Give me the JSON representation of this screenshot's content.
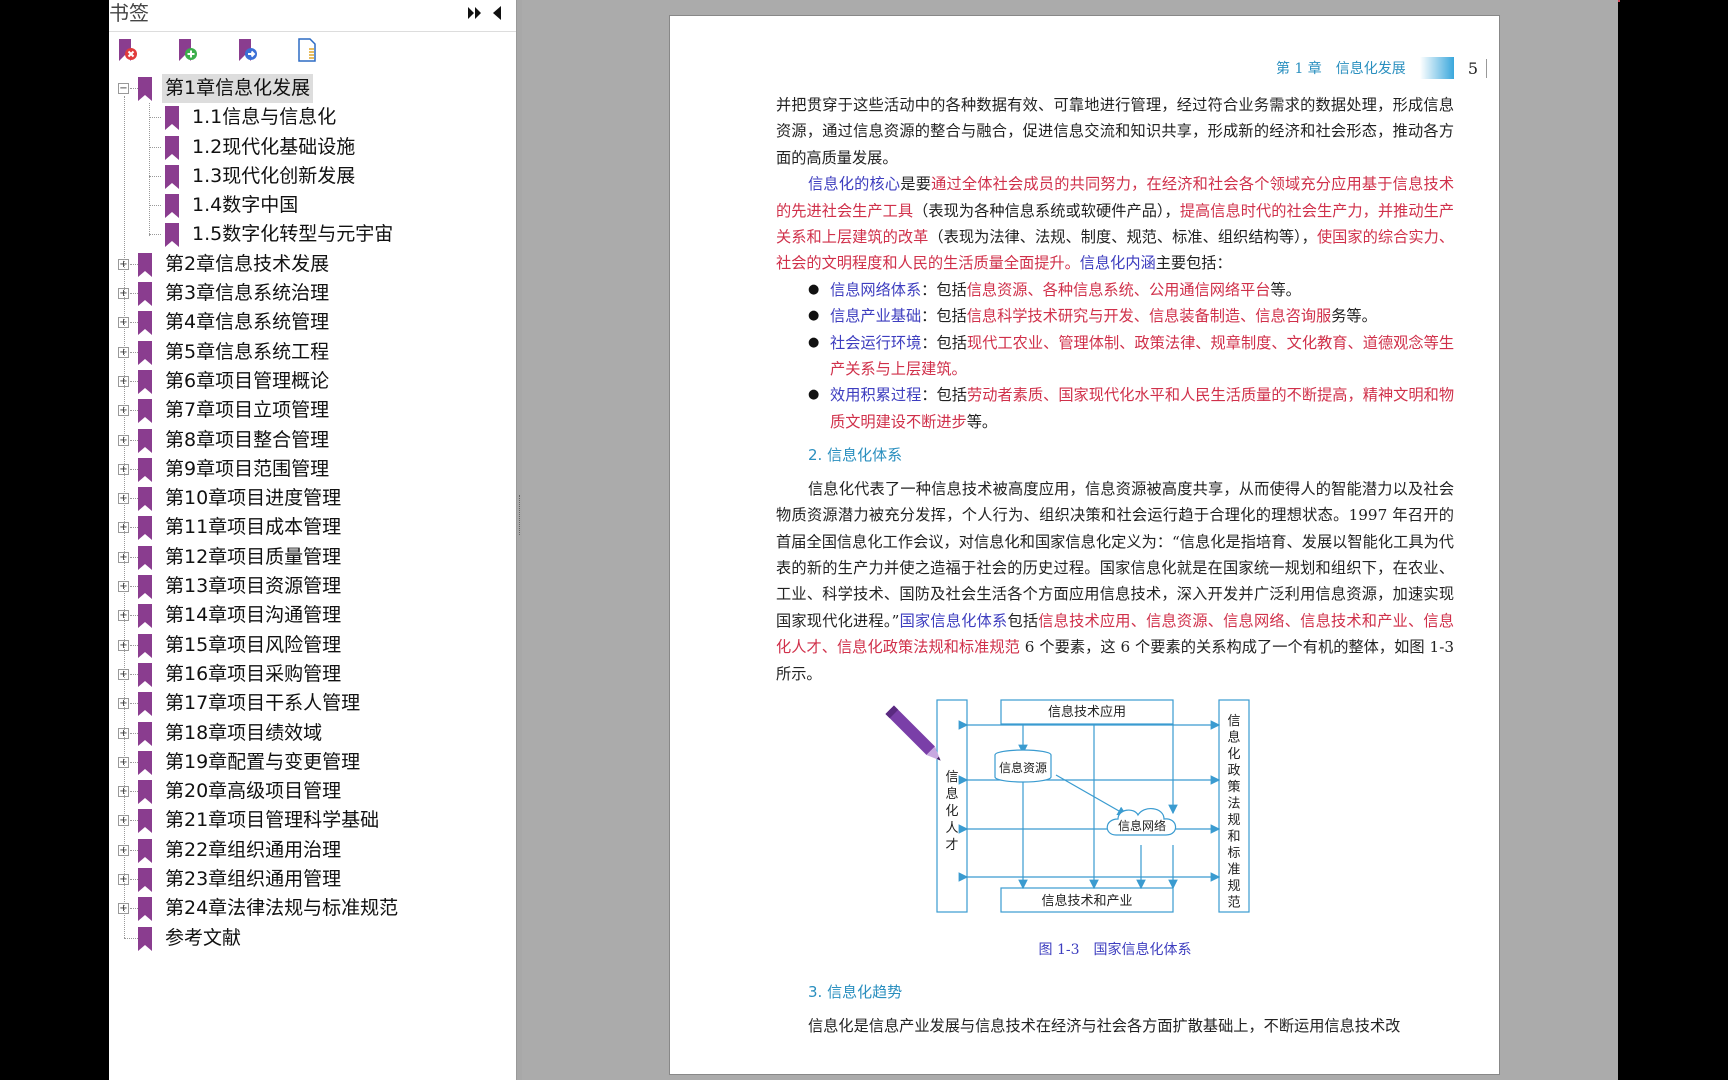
{
  "sidebar": {
    "title": "书签",
    "toolbar_icons": [
      "delete-bookmark-icon",
      "add-bookmark-icon",
      "go-to-bookmark-icon",
      "bookmark-properties-icon"
    ],
    "items": [
      {
        "label": "第1章信息化发展",
        "expanded": true,
        "selected": true,
        "children": [
          "1.1信息与信息化",
          "1.2现代化基础设施",
          "1.3现代化创新发展",
          "1.4数字中国",
          "1.5数字化转型与元宇宙"
        ]
      },
      {
        "label": "第2章信息技术发展"
      },
      {
        "label": "第3章信息系统治理"
      },
      {
        "label": "第4章信息系统管理"
      },
      {
        "label": "第5章信息系统工程"
      },
      {
        "label": "第6章项目管理概论"
      },
      {
        "label": "第7章项目立项管理"
      },
      {
        "label": "第8章项目整合管理"
      },
      {
        "label": "第9章项目范围管理"
      },
      {
        "label": "第10章项目进度管理"
      },
      {
        "label": "第11章项目成本管理"
      },
      {
        "label": "第12章项目质量管理"
      },
      {
        "label": "第13章项目资源管理"
      },
      {
        "label": "第14章项目沟通管理"
      },
      {
        "label": "第15章项目风险管理"
      },
      {
        "label": "第16章项目采购管理"
      },
      {
        "label": "第17章项目干系人管理"
      },
      {
        "label": "第18章项目绩效域"
      },
      {
        "label": "第19章配置与变更管理"
      },
      {
        "label": "第20章高级项目管理"
      },
      {
        "label": "第21章项目管理科学基础"
      },
      {
        "label": "第22章组织通用治理"
      },
      {
        "label": "第23章组织通用管理"
      },
      {
        "label": "第24章法律法规与标准规范"
      },
      {
        "label": "参考文献",
        "leaf": true
      }
    ]
  },
  "page": {
    "running_head": "第 1 章　信息化发展",
    "page_number": "5",
    "p1": "并把贯穿于这些活动中的各种数据有效、可靠地进行管理，经过符合业务需求的数据处理，形成信息资源，通过信息资源的整合与融合，促进信息交流和知识共享，形成新的经济和社会形态，推动各方面的高质量发展。",
    "p2": {
      "a": "信息化的核心",
      "b": "是要",
      "c": "通过全体社会成员的共同努力，在经济和社会各个领域充分应用基于信息技术的先进社会生产工具",
      "d": "（表现为各种信息系统或软硬件产品），",
      "e": "提高信息时代的社会生产力，并推动生产关系和上层建筑的改革",
      "f": "（表现为法律、法规、制度、规范、标准、组织结构等），",
      "g": "使国家的综合实力、社会的文明程度和人民的生活质量全面提升。",
      "h": "信息化内涵",
      "i": "主要包括："
    },
    "bullets": [
      {
        "term": "信息网络体系",
        "sep": "：包括",
        "red": "信息资源、各种信息系统、公用通信网络平台",
        "tail": "等。"
      },
      {
        "term": "信息产业基础",
        "sep": "：包括",
        "red": "信息科学技术研究与开发、信息装备制造、信息咨询服",
        "tail": "务等。"
      },
      {
        "term": "社会运行环境",
        "sep": "：包括",
        "red": "现代工农业、管理体制、政策法律、规章制度、文化教育、道德观念等生产关系与上层建筑。",
        "tail": ""
      },
      {
        "term": "效用积累过程",
        "sep": "：包括",
        "red": "劳动者素质、国家现代化水平和人民生活质量的不断提高，精神文明和物质文明建设不断进步",
        "tail": "等。"
      }
    ],
    "section2": "2. 信息化体系",
    "p3": "信息化代表了一种信息技术被高度应用，信息资源被高度共享，从而使得人的智能潜力以及社会物质资源潜力被充分发挥，个人行为、组织决策和社会运行趋于合理化的理想状态。1997 年召开的首届全国信息化工作会议，对信息化和国家信息化定义为：“信息化是指培育、发展以智能化工具为代表的新的生产力并使之造福于社会的历史过程。国家信息化就是在国家统一规划和组织下，在农业、工业、科学技术、国防及社会生活各个方面应用信息技术，深入开发并广泛利用信息资源，加速实现国家现代化进程。”",
    "p3b": {
      "a": "国家信息化体系",
      "b": "包括",
      "c": "信息技术应用、信息资源、信息网络、信息技术和产业、信息化人才、信息化政策法规和标准规范",
      "d": " 6 个要素，这 6 个要素的关系构成了一个有机的整体，如图 1-3 所示。"
    },
    "figure": {
      "top": "信息技术应用",
      "resource": "信息资源",
      "network": "信息网络",
      "bottom": "信息技术和产业",
      "left": "信息化人才",
      "right": "信息化政策法规和标准规范",
      "caption": "图 1-3　国家信息化体系"
    },
    "section3": "3. 信息化趋势",
    "p4": "信息化是信息产业发展与信息技术在经济与社会各方面扩散基础上，不断运用信息技术改"
  },
  "colors": {
    "link_blue": "#3d3dbf",
    "emphasis_red": "#d0304a",
    "heading_blue": "#2a8fbf",
    "bookmark_purple": "#8a3d8f"
  }
}
